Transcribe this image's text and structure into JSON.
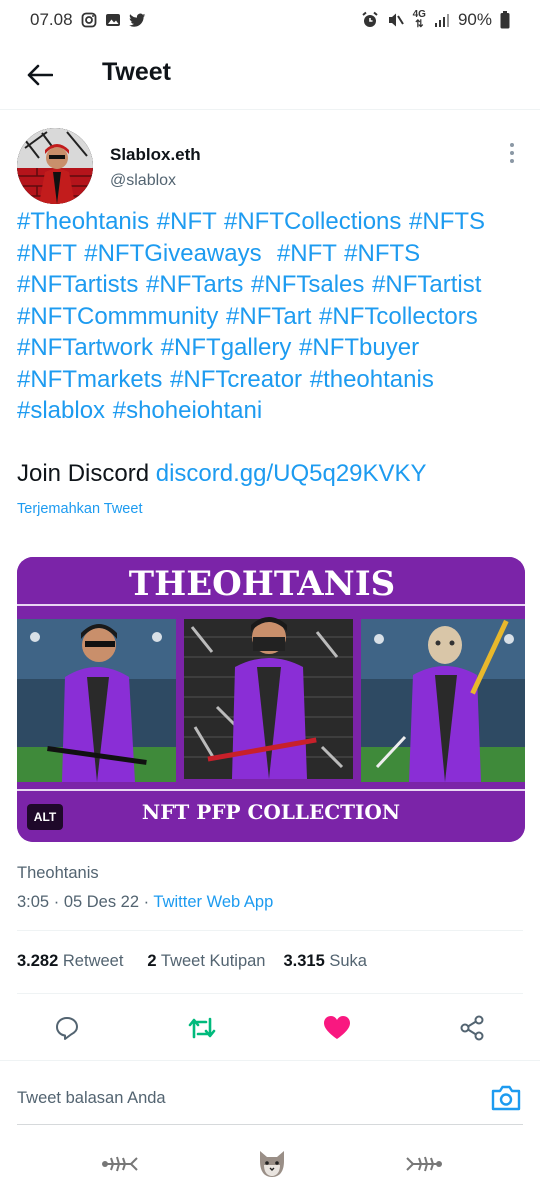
{
  "status_bar": {
    "time": "07.08",
    "network": "4G",
    "battery": "90%",
    "left_icons": [
      "instagram-icon",
      "gallery-icon",
      "twitter-icon"
    ],
    "right_icons": [
      "alarm-icon",
      "mute-icon",
      "network-icon",
      "signal-icon",
      "battery-icon"
    ]
  },
  "header": {
    "title": "Tweet",
    "back_icon": "arrow-left-icon"
  },
  "author": {
    "name": "Slablox.eth",
    "handle": "@slablox"
  },
  "tweet": {
    "hashtag_lines": [
      "#Theohtanis #NFT #NFTCollections #NFTS",
      "#NFT #NFTGiveaways  #NFT #NFTS",
      "#NFTartists #NFTarts #NFTsales #NFTartist",
      "#NFTCommmunity #NFTart #NFTcollectors",
      "#NFTartwork #NFTgallery #NFTbuyer",
      "#NFTmarkets #NFTcreator #theohtanis",
      "#slablox #shoheiohtani"
    ],
    "discord_label": "Join Discord",
    "discord_link": "discord.gg/UQ5q29KVKY",
    "translate": "Terjemahkan Tweet"
  },
  "media": {
    "banner_title": "THEOHTANIS",
    "banner_subtitle": "NFT PFP COLLECTION",
    "alt_badge": "ALT",
    "colors": {
      "banner": "#7b24a8",
      "stadium": "#2e4a63",
      "field": "#3f8a3a",
      "jacket": "#8a2ed6"
    }
  },
  "meta": {
    "source_name": "Theohtanis",
    "time": "3:05",
    "date": "05 Des 22",
    "separator": "·",
    "app": "Twitter Web App"
  },
  "stats": {
    "retweets": "3.282",
    "retweets_label": "Retweet",
    "quotes": "2",
    "quotes_label": "Tweet Kutipan",
    "likes": "3.315",
    "likes_label": "Suka"
  },
  "actions": [
    "reply-icon",
    "retweet-icon",
    "like-icon",
    "share-icon"
  ],
  "reply": {
    "placeholder": "Tweet balasan Anda"
  },
  "colors": {
    "accent": "#1d9bf0",
    "retweet_active": "#00ba7c",
    "like_active": "#f91880",
    "text_secondary": "#536471"
  }
}
